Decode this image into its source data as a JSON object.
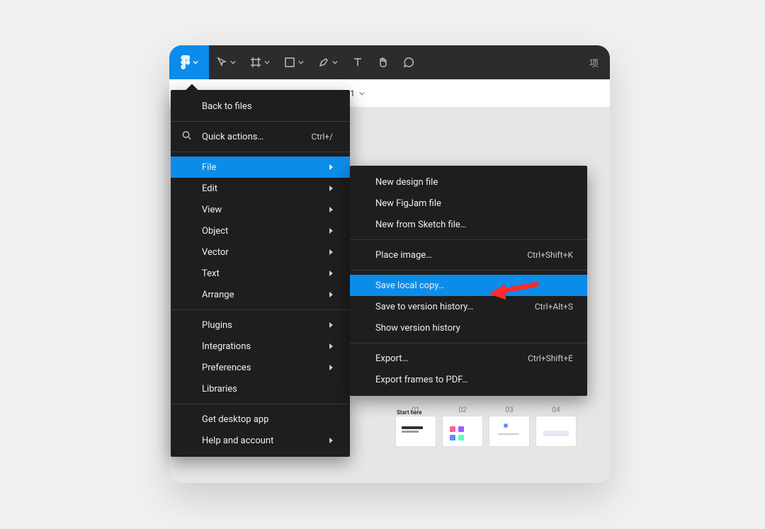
{
  "toolbar": {
    "right_label": "项"
  },
  "secondary": {
    "label": "1"
  },
  "menu": {
    "back": "Back to files",
    "quick": "Quick actions…",
    "quick_shortcut": "Ctrl+/",
    "file": "File",
    "edit": "Edit",
    "view": "View",
    "object": "Object",
    "vector": "Vector",
    "text": "Text",
    "arrange": "Arrange",
    "plugins": "Plugins",
    "integrations": "Integrations",
    "preferences": "Preferences",
    "libraries": "Libraries",
    "desktop": "Get desktop app",
    "help": "Help and account"
  },
  "submenu": {
    "new_design": "New design file",
    "new_figjam": "New FigJam file",
    "new_sketch": "New from Sketch file…",
    "place_image": "Place image…",
    "place_image_shortcut": "Ctrl+Shift+K",
    "save_local": "Save local copy…",
    "save_history": "Save to version history…",
    "save_history_shortcut": "Ctrl+Alt+S",
    "show_history": "Show version history",
    "export": "Export…",
    "export_shortcut": "Ctrl+Shift+E",
    "export_pdf": "Export frames to PDF…"
  },
  "thumbs": {
    "start": "Start here",
    "n0": "01",
    "n1": "02",
    "n2": "03",
    "n3": "04"
  }
}
